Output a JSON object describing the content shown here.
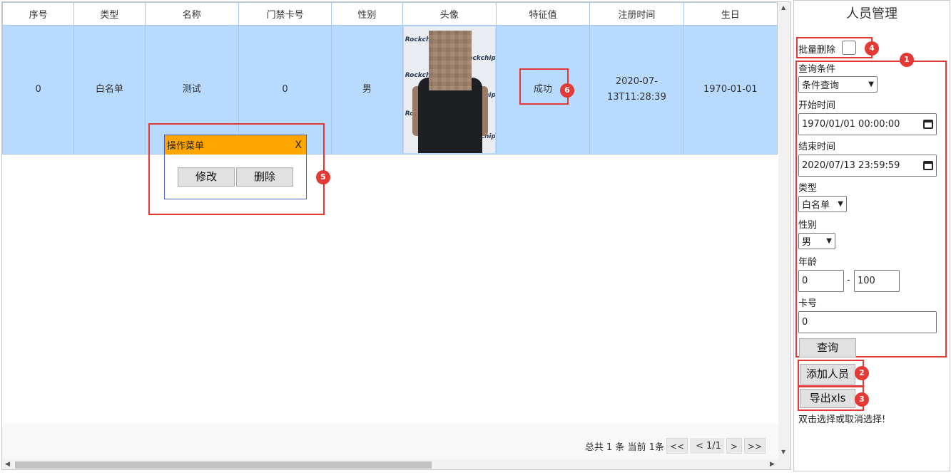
{
  "table": {
    "headers": [
      "序号",
      "类型",
      "名称",
      "门禁卡号",
      "性别",
      "头像",
      "特征值",
      "注册时间",
      "生日"
    ],
    "rows": [
      {
        "index": "0",
        "type": "白名单",
        "name": "测试",
        "card": "0",
        "gender": "男",
        "avatar_brand": "Rockchip",
        "feature": "成功",
        "reg_time_line1": "2020-07-",
        "reg_time_line2": "13T11:28:39",
        "birthday": "1970-01-01"
      }
    ]
  },
  "popup": {
    "title": "操作菜单",
    "close": "X",
    "edit": "修改",
    "delete": "删除"
  },
  "pager": {
    "total": "总共 1 条 当前 1条",
    "first": "<<",
    "prev": "<",
    "page": "1/1",
    "next": ">",
    "last": ">>"
  },
  "panel": {
    "title": "人员管理",
    "batch_delete": "批量删除",
    "query_condition_label": "查询条件",
    "query_condition_value": "条件查询",
    "start_time_label": "开始时间",
    "start_time_value": "1970/01/01 00:00:00",
    "end_time_label": "结束时间",
    "end_time_value": "2020/07/13 23:59:59",
    "type_label": "类型",
    "type_value": "白名单",
    "gender_label": "性别",
    "gender_value": "男",
    "age_label": "年龄",
    "age_min": "0",
    "age_sep": "-",
    "age_max": "100",
    "card_label": "卡号",
    "card_value": "0",
    "query_button": "查询",
    "add_person_button": "添加人员",
    "export_button": "导出xls",
    "hint": "双击选择或取消选择!"
  },
  "annotations": [
    "1",
    "2",
    "3",
    "4",
    "5",
    "6"
  ],
  "colors": {
    "selected_row": "#b9daff",
    "popup_header": "#ffa500",
    "annotation_red": "#e53935"
  }
}
